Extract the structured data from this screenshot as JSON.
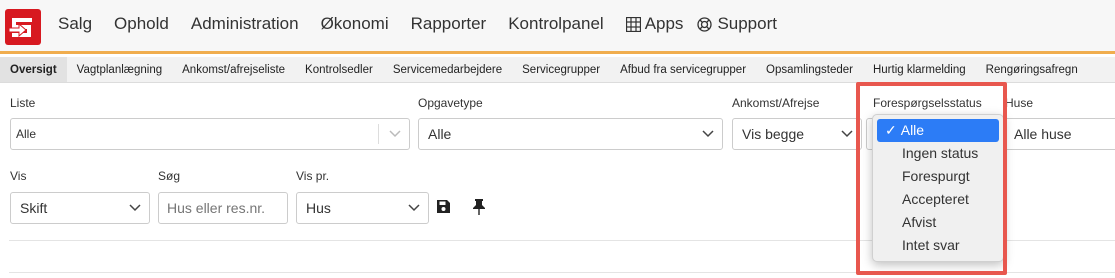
{
  "nav": {
    "items": [
      "Salg",
      "Ophold",
      "Administration",
      "Økonomi",
      "Rapporter",
      "Kontrolpanel"
    ],
    "apps": "Apps",
    "support": "Support"
  },
  "subnav": [
    "Oversigt",
    "Vagtplanlægning",
    "Ankomst/afrejseliste",
    "Kontrolsedler",
    "Servicemedarbejdere",
    "Servicegrupper",
    "Afbud fra servicegrupper",
    "Opsamlingsteder",
    "Hurtig klarmelding",
    "Rengøringsafregn"
  ],
  "filters": {
    "liste_label": "Liste",
    "liste_value": "Alle",
    "opgavetype_label": "Opgavetype",
    "opgavetype_value": "Alle",
    "ankomst_label": "Ankomst/Afrejse",
    "ankomst_value": "Vis begge",
    "status_label": "Forespørgselsstatus",
    "huse_label": "Huse",
    "huse_value": "Alle huse",
    "vis_label": "Vis",
    "vis_value": "Skift",
    "sog_label": "Søg",
    "sog_placeholder": "Hus eller res.nr.",
    "vispr_label": "Vis pr.",
    "vispr_value": "Hus"
  },
  "status_dropdown": {
    "selected": "Alle",
    "options": [
      "Ingen status",
      "Forespurgt",
      "Accepteret",
      "Afvist",
      "Intet svar"
    ]
  },
  "colors": {
    "brand": "#d71920",
    "accent": "#f0ad4e",
    "highlight": "#e8574e",
    "selected": "#2c7cf6"
  }
}
